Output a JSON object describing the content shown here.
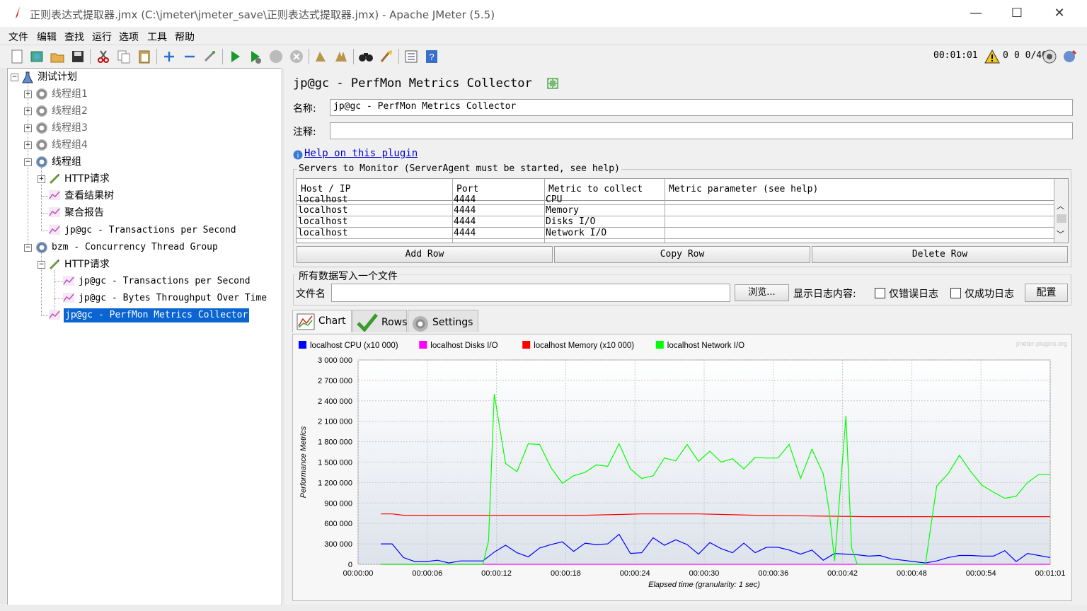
{
  "window": {
    "title": "正则表达式提取器.jmx (C:\\jmeter\\jmeter_save\\正则表达式提取器.jmx) - Apache JMeter (5.5)",
    "minimize": "—",
    "maximize": "☐",
    "close": "✕"
  },
  "menu": [
    "文件",
    "编辑",
    "查找",
    "运行",
    "选项",
    "工具",
    "帮助"
  ],
  "status": {
    "elapsed": "00:01:01",
    "warnings": "0",
    "threads": "0 0/40"
  },
  "tree": [
    {
      "label": "测试计划"
    },
    {
      "label": "线程组1"
    },
    {
      "label": "线程组2"
    },
    {
      "label": "线程组3"
    },
    {
      "label": "线程组4"
    },
    {
      "label": "线程组"
    },
    {
      "label": "HTTP请求"
    },
    {
      "label": "查看结果树"
    },
    {
      "label": "聚合报告"
    },
    {
      "label": "jp@gc - Transactions per Second"
    },
    {
      "label": "bzm - Concurrency Thread Group"
    },
    {
      "label": "HTTP请求"
    },
    {
      "label": "jp@gc - Transactions per Second"
    },
    {
      "label": "jp@gc - Bytes Throughput Over Time"
    },
    {
      "label": "jp@gc - PerfMon Metrics Collector"
    }
  ],
  "panel": {
    "heading": "jp@gc - PerfMon Metrics Collector",
    "name_label": "名称:",
    "name_value": "jp@gc - PerfMon Metrics Collector",
    "comment_label": "注释:",
    "comment_value": "",
    "help_link": "Help on this plugin",
    "servers_title": "Servers to Monitor (ServerAgent must be started, see help)",
    "columns": [
      "Host / IP",
      "Port",
      "Metric to collect",
      "Metric parameter (see help)"
    ],
    "rows": [
      [
        "localhost",
        "4444",
        "CPU",
        ""
      ],
      [
        "localhost",
        "4444",
        "Memory",
        ""
      ],
      [
        "localhost",
        "4444",
        "Disks I/O",
        ""
      ],
      [
        "localhost",
        "4444",
        "Network I/O",
        ""
      ]
    ],
    "add_row": "Add Row",
    "copy_row": "Copy Row",
    "delete_row": "Delete Row",
    "file_section": "所有数据写入一个文件",
    "filename_label": "文件名",
    "filename_value": "",
    "browse": "浏览...",
    "log_label": "显示日志内容:",
    "errors_only": "仅错误日志",
    "success_only": "仅成功日志",
    "configure": "配置",
    "tabs": [
      "Chart",
      "Rows",
      "Settings"
    ]
  },
  "colors": {
    "cpu": "#0000ff",
    "disks": "#ff00ff",
    "memory": "#ff0000",
    "network": "#00ff00",
    "selection": "#0a64d2"
  },
  "chart_data": {
    "type": "line",
    "watermark": "jmeter-plugins.org",
    "ylabel": "Performance Metrics",
    "xlabel": "Elapsed time (granularity: 1 sec)",
    "ylim": [
      0,
      3000000
    ],
    "yticks": [
      "3 000 000",
      "2 700 000",
      "2 400 000",
      "2 100 000",
      "1 800 000",
      "1 500 000",
      "1 200 000",
      "900 000",
      "600 000",
      "300 000",
      "0"
    ],
    "xticks": [
      "00:00:00",
      "00:00:06",
      "00:00:12",
      "00:00:18",
      "00:00:24",
      "00:00:30",
      "00:00:36",
      "00:00:42",
      "00:00:48",
      "00:00:54",
      "00:01:01"
    ],
    "xlim": [
      0,
      61
    ],
    "series": [
      {
        "name": "localhost CPU (x10 000)",
        "color": "#0000ff",
        "x": [
          2,
          3,
          4,
          5,
          6,
          7,
          8,
          9,
          10,
          11,
          12,
          13,
          14,
          15,
          16,
          17,
          18,
          19,
          20,
          21,
          22,
          23,
          24,
          25,
          26,
          27,
          28,
          29,
          30,
          31,
          32,
          33,
          34,
          35,
          36,
          37,
          38,
          39,
          40,
          41,
          42,
          43,
          44,
          45,
          46,
          47,
          48,
          49,
          50,
          51,
          52,
          53,
          54,
          55,
          56,
          57,
          58,
          59,
          60,
          61
        ],
        "y": [
          300000,
          300000,
          100000,
          40000,
          40000,
          60000,
          20000,
          50000,
          50000,
          50000,
          180000,
          280000,
          170000,
          110000,
          240000,
          290000,
          330000,
          190000,
          310000,
          290000,
          300000,
          440000,
          160000,
          170000,
          390000,
          280000,
          360000,
          290000,
          150000,
          320000,
          230000,
          170000,
          310000,
          170000,
          250000,
          250000,
          210000,
          150000,
          210000,
          60000,
          160000,
          150000,
          140000,
          120000,
          130000,
          80000,
          60000,
          40000,
          20000,
          50000,
          100000,
          130000,
          130000,
          120000,
          120000,
          200000,
          40000,
          160000,
          130000,
          100000
        ]
      },
      {
        "name": "localhost Disks I/O",
        "color": "#ff00ff",
        "x": [
          2,
          61
        ],
        "y": [
          0,
          0
        ]
      },
      {
        "name": "localhost Memory (x10 000)",
        "color": "#ff0000",
        "x": [
          2,
          3,
          4,
          5,
          10,
          20,
          25,
          30,
          35,
          40,
          45,
          50,
          55,
          61
        ],
        "y": [
          740000,
          740000,
          720000,
          720000,
          720000,
          720000,
          740000,
          740000,
          720000,
          710000,
          700000,
          700000,
          700000,
          700000
        ]
      },
      {
        "name": "localhost Network I/O",
        "color": "#00ff00",
        "x": [
          2,
          3,
          4,
          5,
          6,
          7,
          8,
          9,
          10,
          11,
          11.5,
          12,
          13,
          14,
          15,
          16,
          17,
          18,
          19,
          20,
          21,
          22,
          23,
          24,
          25,
          26,
          27,
          28,
          29,
          30,
          31,
          32,
          33,
          34,
          35,
          36,
          37,
          38,
          39,
          40,
          41,
          41.5,
          42,
          43,
          43.5,
          44,
          45,
          46,
          47,
          48,
          49,
          50,
          51,
          52,
          53,
          54,
          55,
          56,
          57,
          58,
          59,
          60,
          61
        ],
        "y": [
          0,
          0,
          0,
          0,
          0,
          0,
          0,
          0,
          0,
          0,
          350000,
          2500000,
          1480000,
          1360000,
          1770000,
          1760000,
          1420000,
          1190000,
          1300000,
          1350000,
          1460000,
          1440000,
          1770000,
          1400000,
          1260000,
          1300000,
          1560000,
          1520000,
          1760000,
          1510000,
          1660000,
          1500000,
          1550000,
          1400000,
          1570000,
          1560000,
          1560000,
          1760000,
          1260000,
          1690000,
          1330000,
          800000,
          50000,
          2180000,
          240000,
          0,
          0,
          0,
          0,
          0,
          0,
          0,
          1150000,
          1330000,
          1600000,
          1360000,
          1160000,
          1060000,
          970000,
          1000000,
          1200000,
          1320000,
          1320000
        ]
      }
    ]
  }
}
